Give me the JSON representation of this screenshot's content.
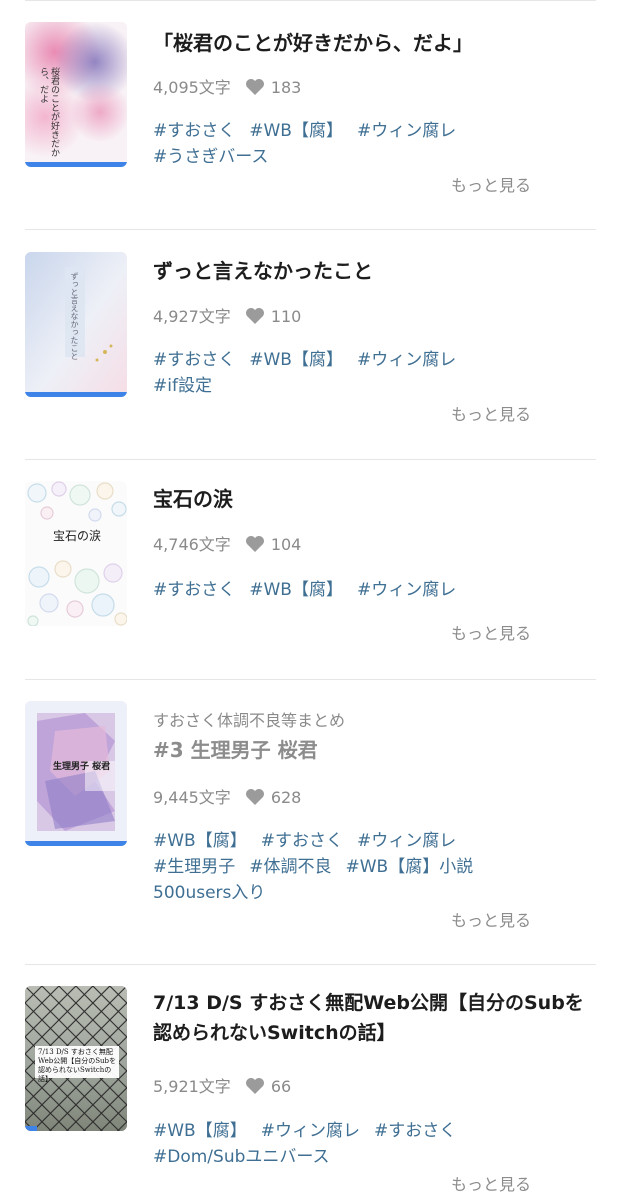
{
  "colors": {
    "tag": "#3f6f93",
    "meta": "#8a8a8a",
    "accent_bar": "#3e84e8",
    "title": "#1d1d1d"
  },
  "more_label": "もっと見る",
  "items": [
    {
      "cover_text": "桜君のことが好きだから、だよ",
      "title": "「桜君のことが好きだから、だよ」",
      "chars": "4,095文字",
      "likes": "183",
      "tags": [
        "#すおさく",
        "#WB【腐】",
        "#ウィン腐レ",
        "#うさぎバース"
      ]
    },
    {
      "cover_text": "ずっと言えなかったこと",
      "title": "ずっと言えなかったこと",
      "chars": "4,927文字",
      "likes": "110",
      "tags": [
        "#すおさく",
        "#WB【腐】",
        "#ウィン腐レ",
        "#if設定"
      ]
    },
    {
      "cover_text": "宝石の涙",
      "title": "宝石の涙",
      "chars": "4,746文字",
      "likes": "104",
      "tags": [
        "#すおさく",
        "#WB【腐】",
        "#ウィン腐レ"
      ]
    },
    {
      "cover_text": "生理男子 桜君",
      "series": "すおさく体調不良等まとめ",
      "title": "#3 生理男子 桜君",
      "chars": "9,445文字",
      "likes": "628",
      "tags": [
        "#WB【腐】",
        "#すおさく",
        "#ウィン腐レ",
        "#生理男子",
        "#体調不良",
        "#WB【腐】小説",
        "500users入り"
      ]
    },
    {
      "cover_text": "7/13 D/S すおさく無配Web公開【自分のSubを認められないSwitchの話】",
      "title": "7/13 D/S すおさく無配Web公開【自分のSubを認められないSwitchの話】",
      "chars": "5,921文字",
      "likes": "66",
      "tags": [
        "#WB【腐】",
        "#ウィン腐レ",
        "#すおさく",
        "#Dom/Subユニバース"
      ]
    }
  ]
}
